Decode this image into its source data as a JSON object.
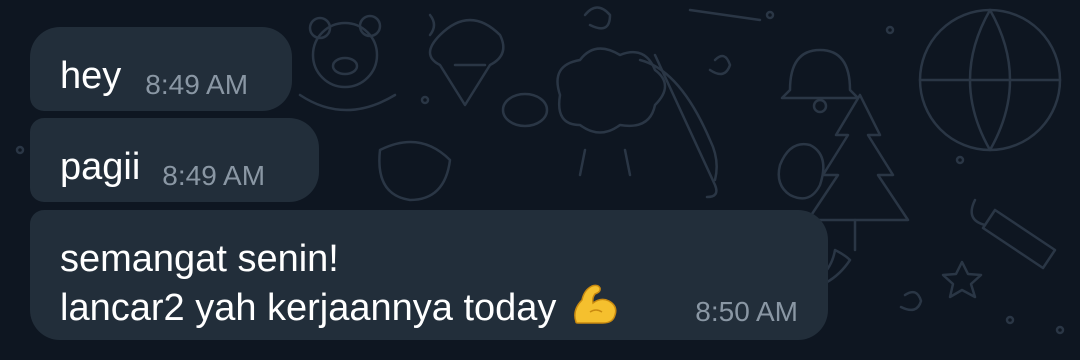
{
  "theme": {
    "background": "#0e1621",
    "bubble_color": "#222e3a",
    "text_color": "#ffffff",
    "time_color": "#8a97a4",
    "emoji_color": "#f5c02e"
  },
  "messages": [
    {
      "text": "hey",
      "time": "8:49 AM"
    },
    {
      "text": "pagii",
      "time": "8:49 AM"
    },
    {
      "lines": [
        "semangat senin!",
        "lancar2 yah kerjaannya today"
      ],
      "emoji": "flexed-biceps",
      "time": "8:50 AM"
    }
  ]
}
